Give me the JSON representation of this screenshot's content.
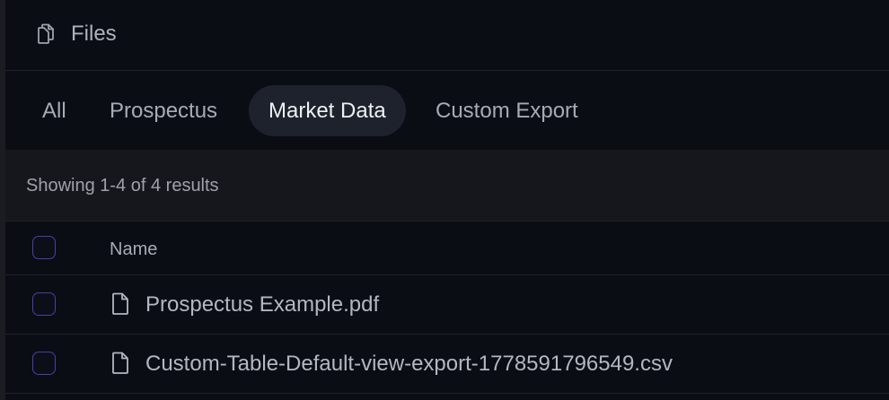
{
  "header": {
    "icon": "files-icon",
    "title": "Files"
  },
  "tabs": [
    {
      "label": "All",
      "active": false
    },
    {
      "label": "Prospectus",
      "active": false
    },
    {
      "label": "Market Data",
      "active": true
    },
    {
      "label": "Custom Export",
      "active": false
    }
  ],
  "results": {
    "summary": "Showing 1-4 of 4 results"
  },
  "table": {
    "columns": [
      "Name"
    ],
    "rows": [
      {
        "name": "Prospectus Example.pdf",
        "icon": "file-icon"
      },
      {
        "name": "Custom-Table-Default-view-export-1778591796549.csv",
        "icon": "file-icon"
      }
    ]
  },
  "colors": {
    "background": "#0b0d14",
    "active_tab": "#1e222c",
    "checkbox_border": "#4a3ea8",
    "results_bar": "#15171c"
  }
}
